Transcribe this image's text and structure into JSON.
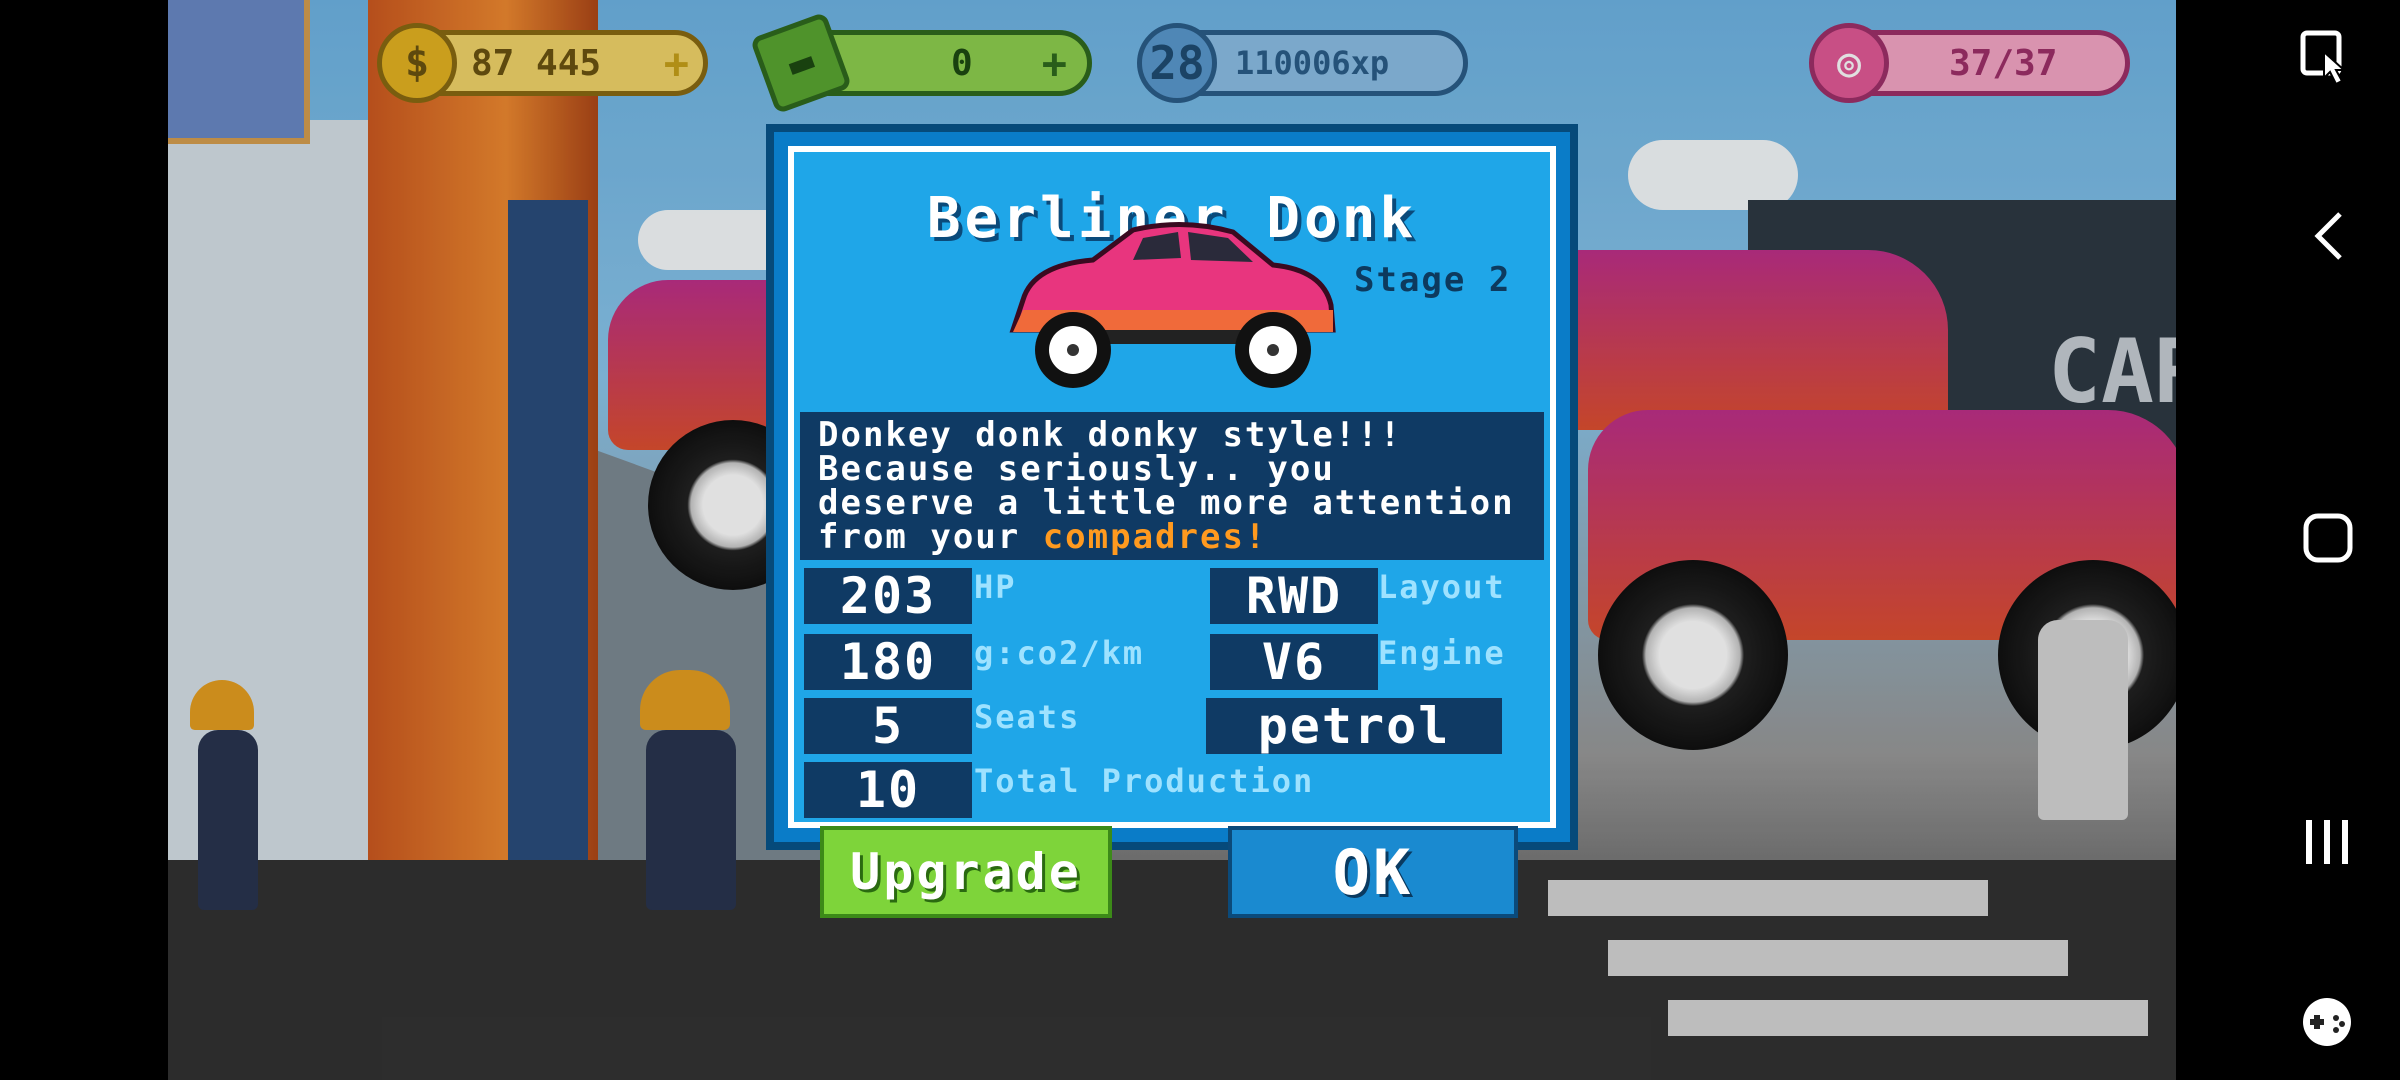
{
  "hud": {
    "money": {
      "value": "87 445",
      "icon": "dollar-coin-icon",
      "symbol": "$",
      "add": "+"
    },
    "cash": {
      "value": "0",
      "icon": "banknote-icon",
      "add": "+"
    },
    "xp": {
      "level": "28",
      "value": "110006xp",
      "icon": "level-badge-icon"
    },
    "donuts": {
      "value": "37/37",
      "icon": "donut-icon"
    }
  },
  "dialog": {
    "title": "Berliner Donk",
    "stage": "Stage 2",
    "description": {
      "line1": "Donkey donk donky style!!!",
      "line2": "Because seriously.. you",
      "line3": "deserve a little more attention",
      "line4_prefix": "from your ",
      "line4_highlight": "compadres!"
    },
    "stats": {
      "hp": {
        "value": "203",
        "label": "HP"
      },
      "co2": {
        "value": "180",
        "label": "g:co2/km"
      },
      "seats": {
        "value": "5",
        "label": "Seats"
      },
      "production": {
        "value": "10",
        "label": "Total Production"
      },
      "layout": {
        "value": "RWD",
        "label": "Layout"
      },
      "engine": {
        "value": "V6",
        "label": "Engine"
      },
      "fuel": {
        "value": "petrol"
      }
    },
    "buttons": {
      "upgrade": "Upgrade",
      "ok": "OK"
    }
  },
  "background": {
    "sign_text": "CAR"
  },
  "system_nav": {
    "icons": [
      "screen-touch-icon",
      "back-arrow-icon",
      "home-square-icon",
      "recent-apps-icon",
      "game-controller-icon"
    ]
  },
  "colors": {
    "dialog": "#1fa6e8",
    "upgrade": "#7ed43a",
    "ok": "#1a8ad0",
    "highlight": "#ff9a1f"
  }
}
